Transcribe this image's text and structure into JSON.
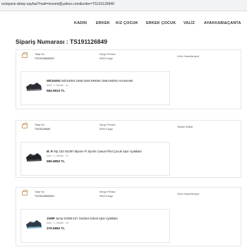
{
  "browser": {
    "url": "ro/siparis-detay-sayfasi?mail=mosmt@yahoo.com&order=TS191126849"
  },
  "nav": {
    "items": [
      "KADIN",
      "ERKEK",
      "KIZ ÇOCUK",
      "ERKEK ÇOCUK",
      "VALİZ",
      "AYAKKABI&ÇANTA"
    ]
  },
  "page": {
    "title": "Sipariş Numarası : TS191126849"
  },
  "labels": {
    "tracking": "Takip No",
    "carrier": "Kargo Firması",
    "unit": "Adet : 1 | Beden : "
  },
  "orders": [
    {
      "tracking_no": "TS191126849201",
      "carrier": "MNG Kargo",
      "status": "Ürün Hazırlanıyor",
      "product": {
        "brand": "WİCKERS",
        "name": "WİCKERS 2465-2046 ERKEK SNEAKERS AYAKKABI",
        "size": "41",
        "price": "584.9910 TL"
      }
    },
    {
      "tracking_no": "TS191126849",
      "carrier": "MNG Kargo",
      "status": "Teslim Edildi",
      "product": {
        "brand": "M. P.",
        "name": "Mp 232-3420Fi Mpone Fi Sports Casual Filet Çocuk Spor Ayakkabı",
        "size": "31",
        "price": "589.9850 TL"
      }
    },
    {
      "tracking_no": "TS191126849201",
      "carrier": "MNG Kargo",
      "status": "Ürün Hazırlanıyor",
      "product": {
        "brand": "JUMP",
        "name": "Jump 21088-22Y Outdoor Erkek Spor Ayakkabı",
        "size": "44",
        "price": "379.9950 TL"
      }
    }
  ],
  "colors": {
    "accent": "#c9a06b",
    "border": "#e6e6e6",
    "text": "#222222"
  },
  "icons": {
    "order": "package-icon"
  }
}
